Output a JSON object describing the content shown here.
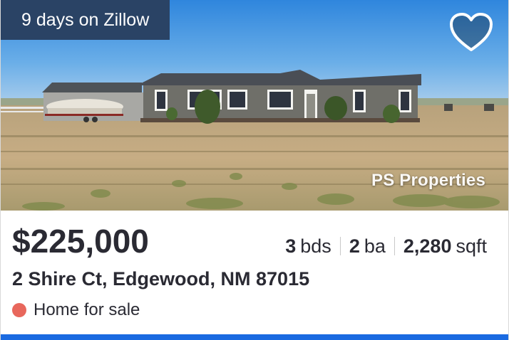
{
  "listing": {
    "days_badge": "9 days on Zillow",
    "watermark": "PS Properties",
    "price": "$225,000",
    "beds_value": "3",
    "beds_label": "bds",
    "baths_value": "2",
    "baths_label": "ba",
    "sqft_value": "2,280",
    "sqft_label": "sqft",
    "address": "2 Shire Ct, Edgewood, NM 87015",
    "status": "Home for sale"
  },
  "icons": {
    "favorite": "heart-outline-icon",
    "status": "status-dot-icon"
  },
  "colors": {
    "badge_bg": "#2a4365",
    "status_dot": "#e8675c",
    "accent_bar": "#1a6ae1",
    "text": "#2a2a33"
  }
}
